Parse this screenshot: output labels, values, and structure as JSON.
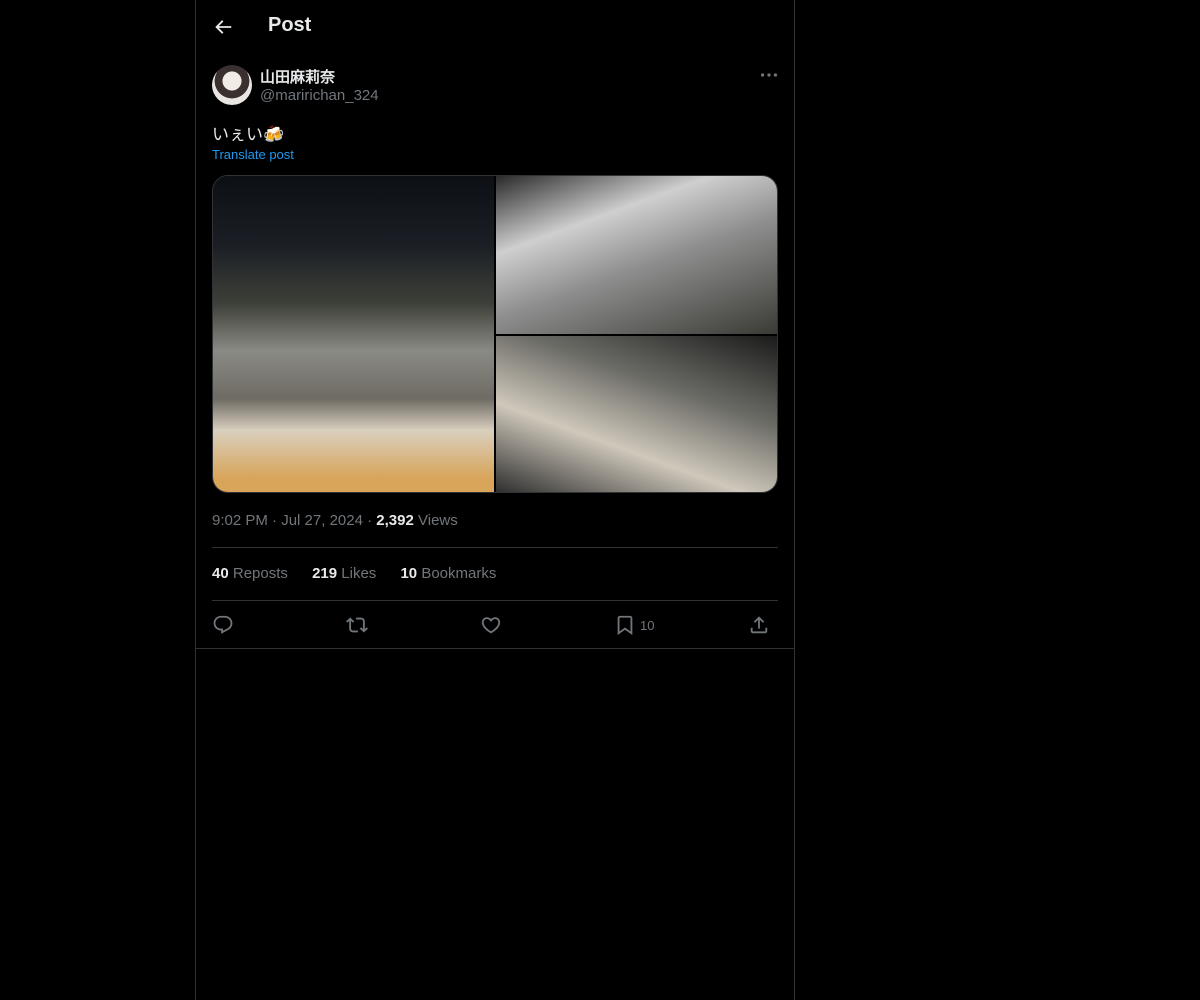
{
  "header": {
    "title": "Post"
  },
  "author": {
    "display_name": "山田麻莉奈",
    "handle": "@maririchan_324"
  },
  "tweet": {
    "text": "いぇい🍻",
    "translate_label": "Translate post",
    "time": "9:02 PM",
    "date": "Jul 27, 2024",
    "views_count": "2,392",
    "views_label": "Views",
    "separator": "·"
  },
  "stats": {
    "reposts_count": "40",
    "reposts_label": "Reposts",
    "likes_count": "219",
    "likes_label": "Likes",
    "bookmarks_count": "10",
    "bookmarks_label": "Bookmarks"
  },
  "actions": {
    "bookmark_count": "10"
  },
  "colors": {
    "background": "#000000",
    "text": "#e7e9ea",
    "muted": "#71767b",
    "link": "#1d9bf0",
    "border": "#2f3336"
  },
  "icons": [
    "back-arrow-icon",
    "more-icon",
    "reply-icon",
    "repost-icon",
    "like-icon",
    "bookmark-icon",
    "share-icon"
  ]
}
